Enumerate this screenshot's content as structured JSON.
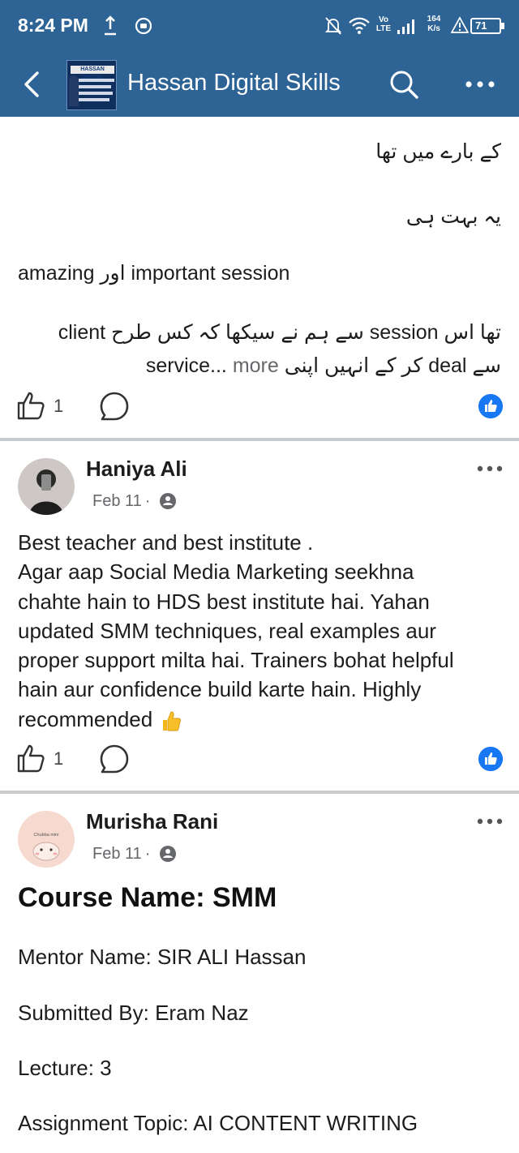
{
  "status_bar": {
    "time": "8:24 PM",
    "net_vo": "Vo",
    "net_lte": "LTE",
    "speed_value": "164",
    "speed_unit": "K/s",
    "battery": "71",
    "icons": [
      "upload-icon",
      "app-notification-icon",
      "mute-icon",
      "wifi-icon",
      "signal-icon",
      "alert-icon",
      "battery-icon"
    ]
  },
  "header": {
    "group_name": "Hassan Digital Skills",
    "logo_text": "HASSAN DIGITAL",
    "icons": [
      "back-arrow-icon",
      "search-icon",
      "more-dots-icon"
    ]
  },
  "post_top": {
    "urdu_line_1": "کے بارے میں تھا",
    "urdu_line_2": "یہ بہت ہی",
    "mixed_line_1_prefix": "amazing",
    "mixed_line_1_urdu": "اور",
    "mixed_line_1_suffix": "important session",
    "mixed_line_2": "تھا اس session سے ہم نے سیکھا کہ کس طرح client",
    "mixed_line_3": "سے deal کر کے انہیں اپنی service...",
    "more_label": "more",
    "like_count": "1"
  },
  "post_haniya": {
    "author": "Haniya Ali",
    "date": "Feb 11",
    "text_line_1": "Best teacher and best institute .",
    "text_lines": [
      "Agar aap Social Media Marketing seekhna",
      "chahte hain to HDS best institute hai. Yahan",
      "updated SMM techniques, real examples aur",
      "proper support milta hai. Trainers bohat helpful",
      "hain aur confidence build karte hain. Highly"
    ],
    "text_last": "recommended",
    "like_count": "1"
  },
  "post_murisha": {
    "author": "Murisha Rani",
    "date": "Feb 11",
    "avatar_text": "Chubba mini",
    "course_title": "Course Name: SMM",
    "mentor": "Mentor Name: SIR ALI Hassan",
    "submitted_by": "Submitted By: Eram Naz",
    "lecture": "Lecture: 3",
    "assignment_topic": "Assignment Topic: AI CONTENT WRITING"
  },
  "colors": {
    "header_bg": "#2d6395",
    "reaction_blue": "#1877f2",
    "meta_gray": "#65676b",
    "separator": "#c9cccf"
  }
}
